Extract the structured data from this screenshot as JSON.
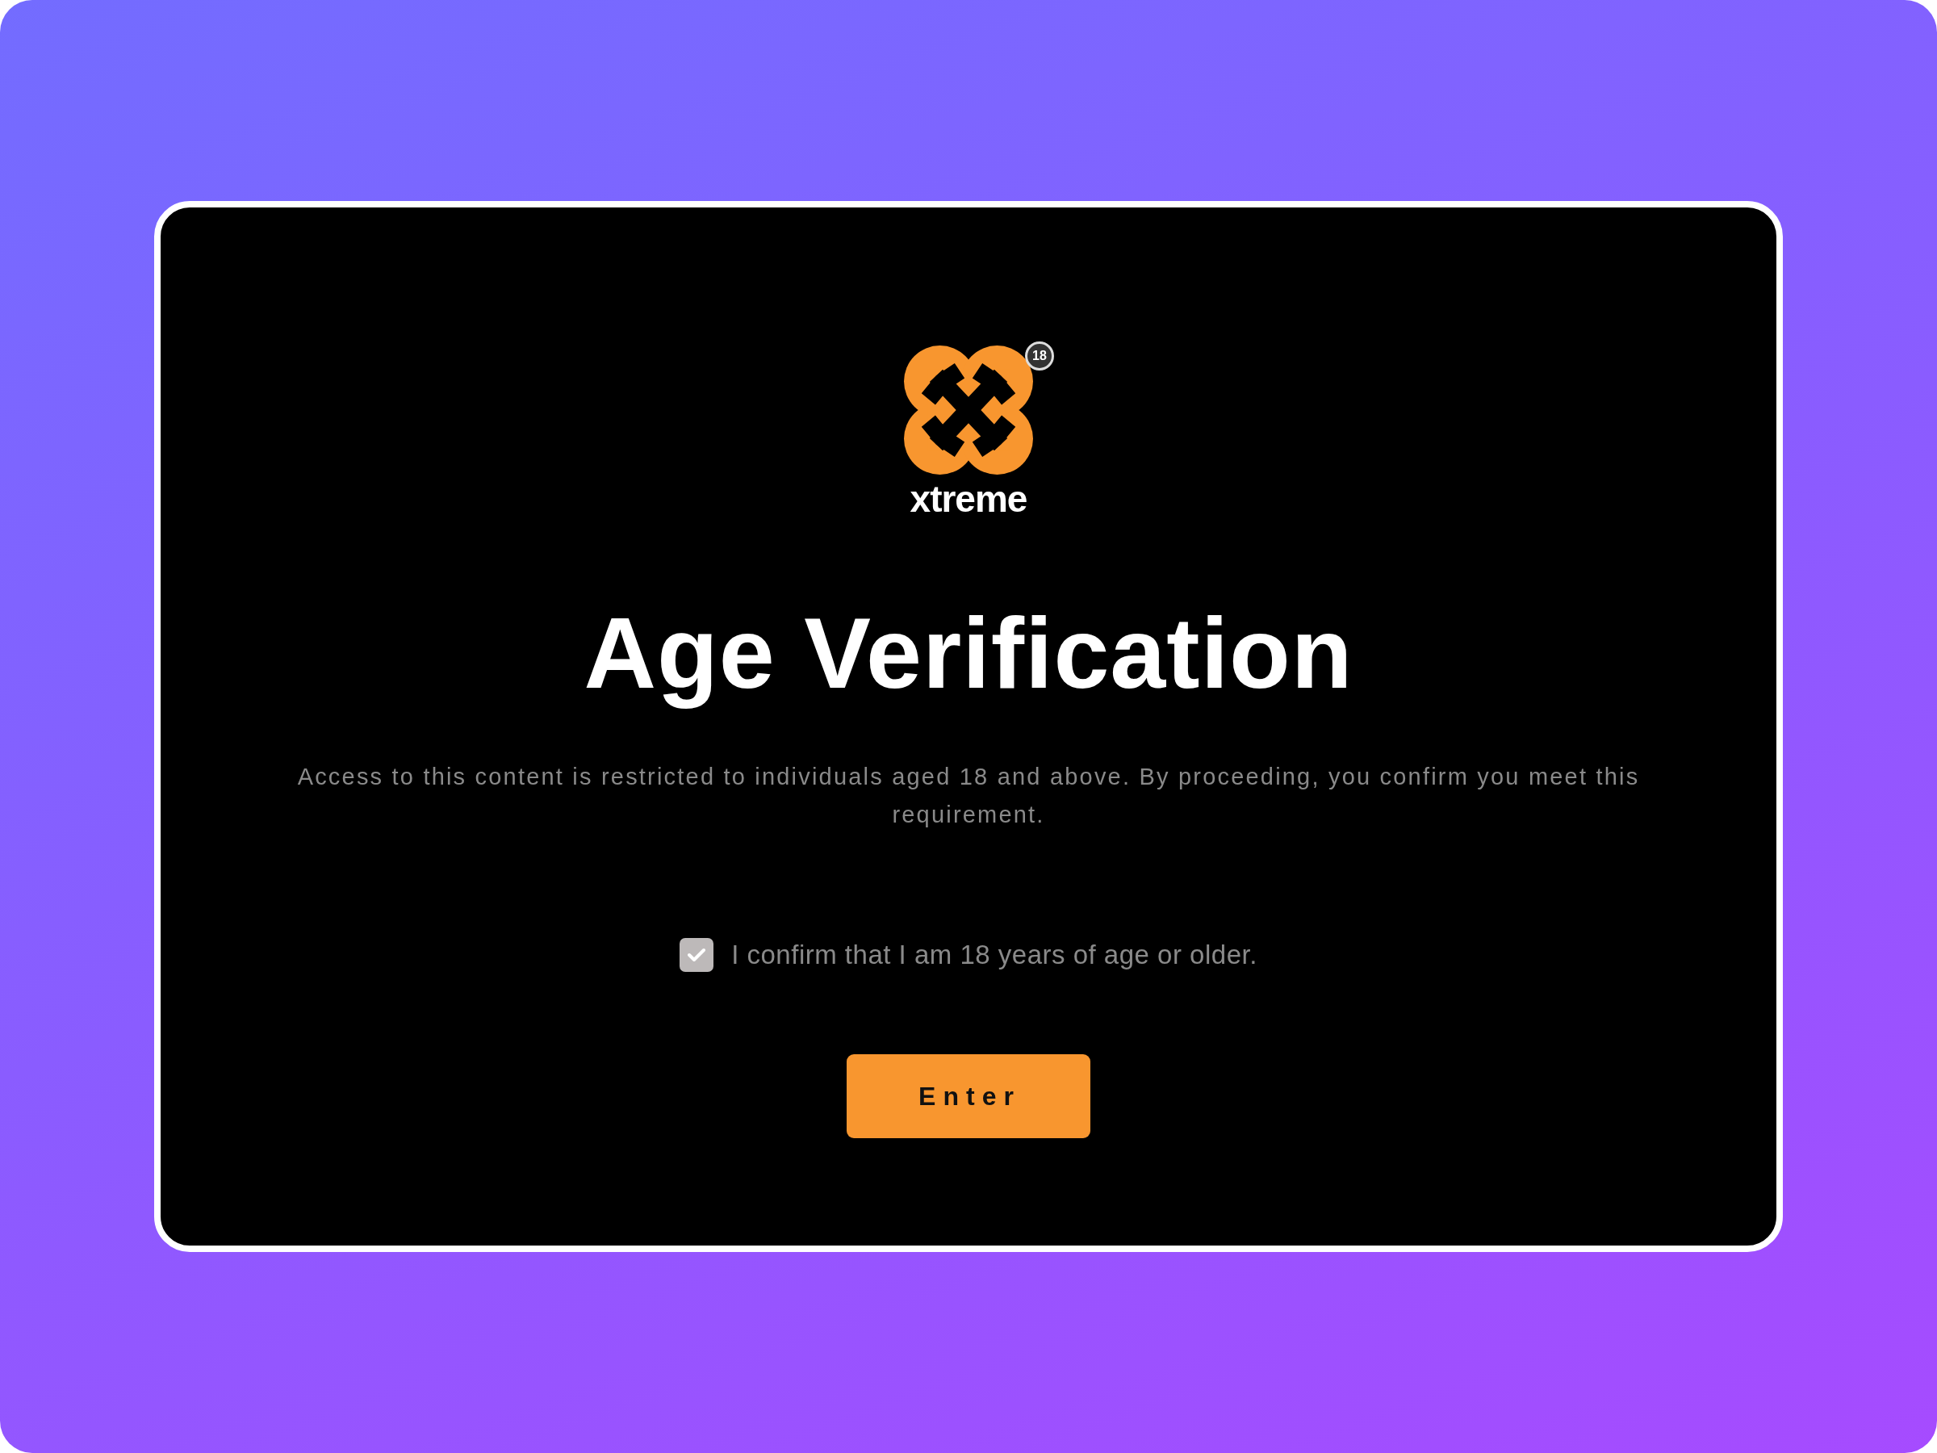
{
  "logo": {
    "wordmark": "xtreme",
    "badge": "18"
  },
  "title": "Age Verification",
  "description": "Access to this content is restricted to individuals aged 18 and above. By proceeding, you confirm you meet this requirement.",
  "confirm": {
    "label": "I confirm that I am 18 years of age or older.",
    "checked": true
  },
  "button": {
    "label": "Enter"
  }
}
